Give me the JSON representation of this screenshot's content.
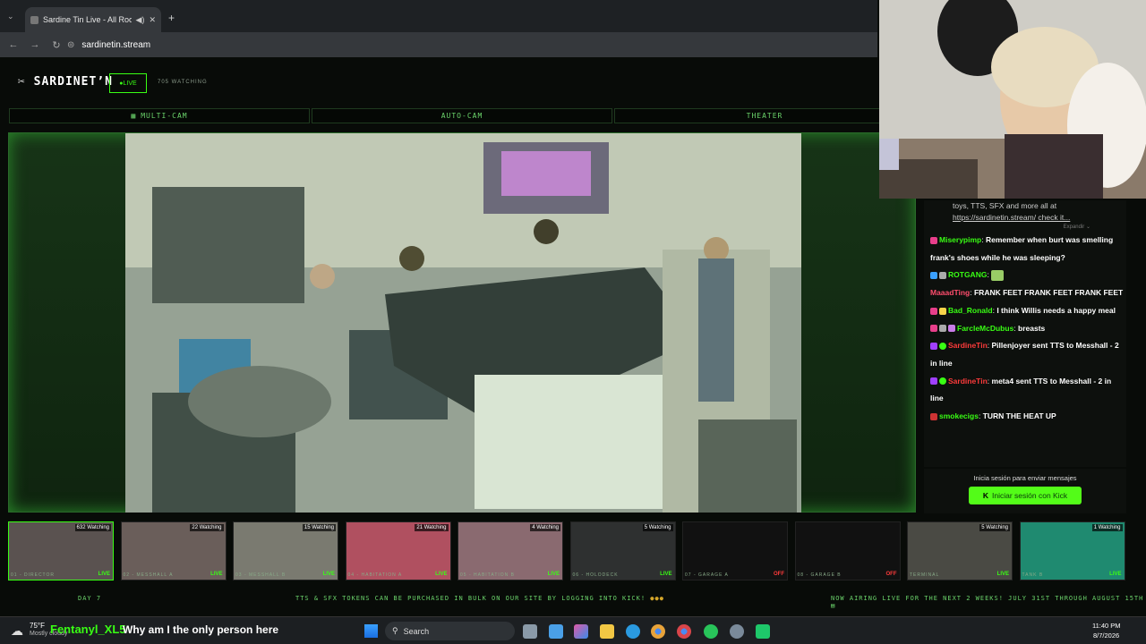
{
  "browser": {
    "tab_title": "Sardine Tin Live - All Rooms",
    "new_tab": "+",
    "url": "sardinetin.stream"
  },
  "site": {
    "logo": "SARDINET’N",
    "live_label": "●LIVE",
    "watching": "705 WATCHING",
    "modes": [
      "MULTI-CAM",
      "AUTO-CAM",
      "THEATER"
    ]
  },
  "chat": {
    "top_text": "toys, TTS, SFX and more all at",
    "top_link": "https://sardinetin.stream/ check it...",
    "expand": "Expandir",
    "messages": [
      {
        "user": "Miserypimp",
        "color": "#39ff14",
        "text": "Remember when burt was smelling frank's shoes while he was sleeping?"
      },
      {
        "user": "ROTGANG",
        "color": "#39ff14",
        "text": ""
      },
      {
        "user": "MaaadTing",
        "color": "#ff4d6d",
        "text": "FRANK FEET FRANK FEET FRANK FEET"
      },
      {
        "user": "Bad_Ronald",
        "color": "#39ff14",
        "text": "I think Willis needs a happy meal"
      },
      {
        "user": "FarcleMcDubus",
        "color": "#39ff14",
        "text": "breasts"
      },
      {
        "user": "SardineTin",
        "color": "#ff3b3b",
        "text": "Pillenjoyer sent TTS to Messhall - 2 in line"
      },
      {
        "user": "SardineTin",
        "color": "#ff3b3b",
        "text": "meta4 sent TTS to Messhall - 2 in line"
      },
      {
        "user": "smokecigs",
        "color": "#39ff14",
        "text": "TURN THE HEAT UP"
      }
    ],
    "login_prompt": "Inicia sesión para enviar mensajes",
    "login_button": "Iniciar sesión con Kick"
  },
  "cams": [
    {
      "watching": "632 Watching",
      "name": "01 - DIRECTOR",
      "status": "LIVE"
    },
    {
      "watching": "22 Watching",
      "name": "02 - MESSHALL A",
      "status": "LIVE"
    },
    {
      "watching": "15 Watching",
      "name": "03 - MESSHALL B",
      "status": "LIVE"
    },
    {
      "watching": "21 Watching",
      "name": "04 - HABITATION A",
      "status": "LIVE"
    },
    {
      "watching": "4 Watching",
      "name": "05 - HABITATION B",
      "status": "LIVE"
    },
    {
      "watching": "5 Watching",
      "name": "06 - HOLODECK",
      "status": "LIVE"
    },
    {
      "watching": "",
      "name": "07 - GARAGE A",
      "status": "OFF"
    },
    {
      "watching": "",
      "name": "08 - GARAGE B",
      "status": "OFF"
    },
    {
      "watching": "5 Watching",
      "name": "TERMINAL",
      "status": "LIVE"
    },
    {
      "watching": "1 Watching",
      "name": "TANK B",
      "status": "LIVE"
    }
  ],
  "ticker": {
    "day": "DAY 7",
    "middle": "TTS & SFX TOKENS CAN BE PURCHASED IN BULK ON OUR SITE BY LOGGING INTO KICK!",
    "right": "NOW AIRING LIVE FOR THE NEXT 2 WEEKS! JULY 31ST THROUGH AUGUST 15TH"
  },
  "taskbar": {
    "temp": "75°F",
    "weather": "Mostly cloudy",
    "overlay_user": "Fentanyl_XL5",
    "overlay_text": "Why am I the only person here",
    "search": "Search",
    "time": "11:40 PM",
    "date": "8/7/2026"
  }
}
